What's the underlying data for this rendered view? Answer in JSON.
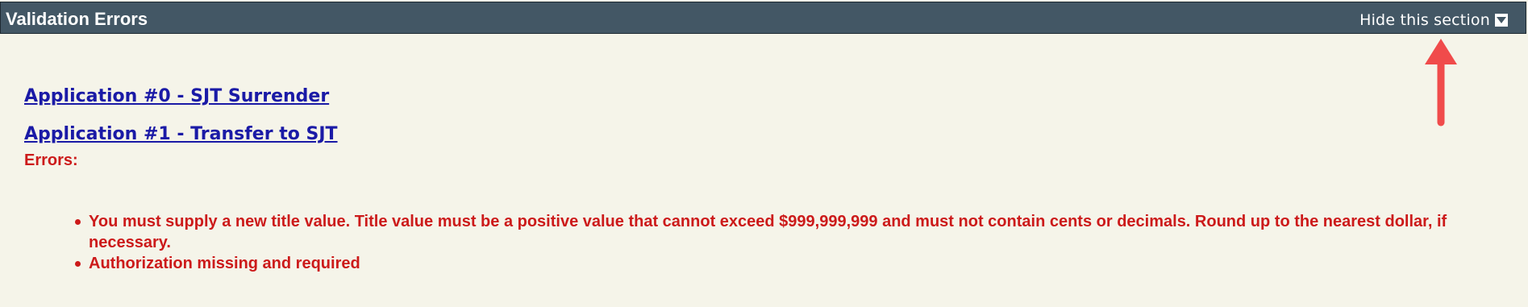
{
  "header": {
    "title": "Validation Errors",
    "hide_toggle_label": "Hide this section"
  },
  "applications": [
    {
      "label": "Application #0 - SJT Surrender"
    },
    {
      "label": "Application #1 - Transfer to SJT"
    }
  ],
  "errors": {
    "label": "Errors:",
    "items": [
      "You must supply a new title value. Title value must be a positive value that cannot exceed $999,999,999 and must not contain cents or decimals. Round up to the nearest dollar, if necessary.",
      "Authorization missing and required"
    ]
  },
  "colors": {
    "header_bg": "#435765",
    "panel_bg": "#f5f4e9",
    "link": "#1a1aa6",
    "error": "#cc1a1a",
    "annotation_arrow": "#f04b4b"
  },
  "icons": {
    "toggle": "chevron-down-icon",
    "annotation": "arrow-up-icon"
  }
}
